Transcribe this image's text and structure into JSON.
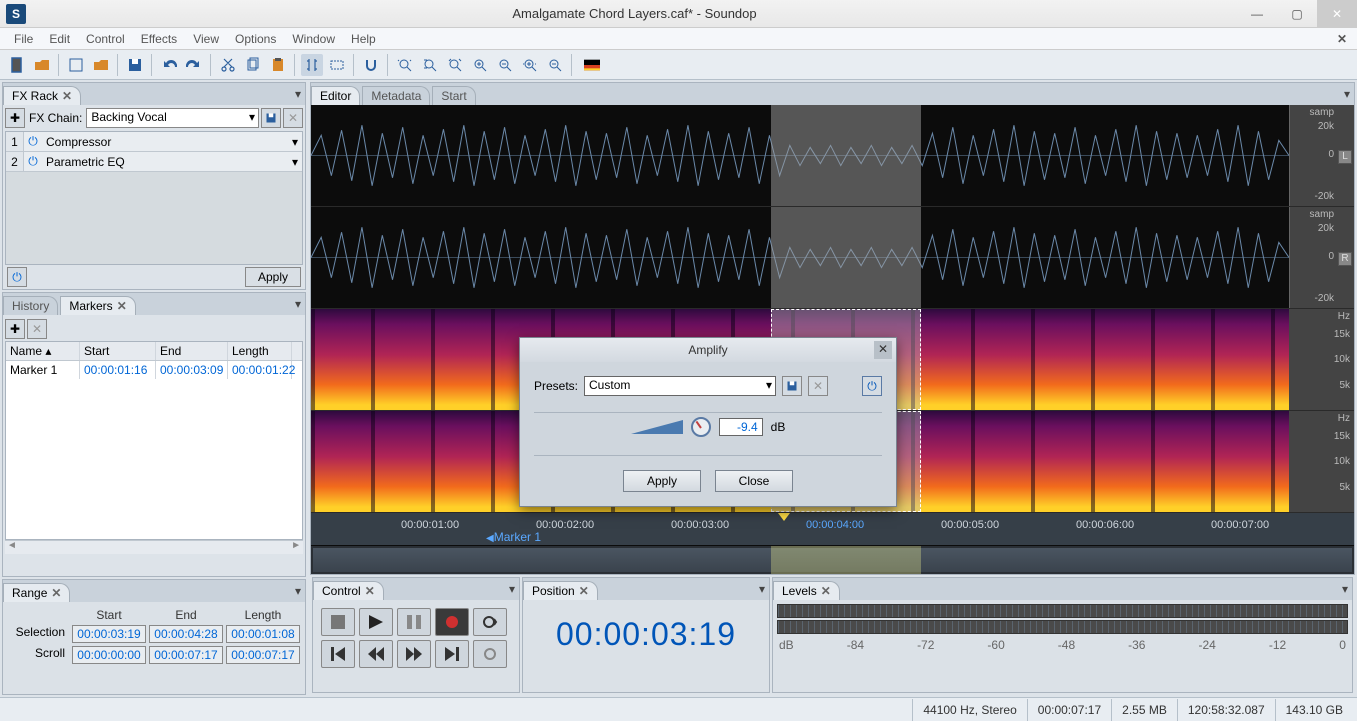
{
  "window": {
    "title": "Amalgamate Chord Layers.caf* - Soundop",
    "app_icon": "S"
  },
  "menu": {
    "items": [
      "File",
      "Edit",
      "Control",
      "Effects",
      "View",
      "Options",
      "Window",
      "Help"
    ]
  },
  "left": {
    "fxrack": {
      "tab": "FX Rack",
      "chain_label": "FX Chain:",
      "chain_value": "Backing Vocal",
      "effects": [
        {
          "idx": "1",
          "name": "Compressor"
        },
        {
          "idx": "2",
          "name": "Parametric EQ"
        }
      ],
      "apply": "Apply"
    },
    "markers": {
      "tabs": [
        "History",
        "Markers"
      ],
      "cols": {
        "name": "Name",
        "start": "Start",
        "end": "End",
        "length": "Length"
      },
      "rows": [
        {
          "name": "Marker 1",
          "start": "00:00:01:16",
          "end": "00:00:03:09",
          "length": "00:00:01:22"
        }
      ]
    }
  },
  "editor": {
    "tabs": [
      "Editor",
      "Metadata",
      "Start"
    ],
    "wave_ruler": {
      "unit": "samp",
      "up": "20k",
      "mid": "0",
      "down": "-20k",
      "chL": "L",
      "chR": "R"
    },
    "spec_ruler": {
      "unit": "Hz",
      "a": "15k",
      "b": "10k",
      "c": "5k"
    },
    "timeline": {
      "ticks": [
        "00:00:01:00",
        "00:00:02:00",
        "00:00:03:00",
        "00:00:04:00",
        "00:00:05:00",
        "00:00:06:00",
        "00:00:07:00"
      ],
      "marker": "Marker 1"
    }
  },
  "bottom": {
    "range": {
      "tab": "Range",
      "hdr": {
        "start": "Start",
        "end": "End",
        "length": "Length"
      },
      "rows": {
        "selection": {
          "label": "Selection",
          "start": "00:00:03:19",
          "end": "00:00:04:28",
          "length": "00:00:01:08"
        },
        "scroll": {
          "label": "Scroll",
          "start": "00:00:00:00",
          "end": "00:00:07:17",
          "length": "00:00:07:17"
        }
      }
    },
    "control": {
      "tab": "Control"
    },
    "position": {
      "tab": "Position",
      "value": "00:00:03:19"
    },
    "levels": {
      "tab": "Levels",
      "unit": "dB",
      "scale": [
        "-84",
        "-72",
        "-60",
        "-48",
        "-36",
        "-24",
        "-12",
        "0"
      ]
    }
  },
  "status": {
    "format": "44100 Hz, Stereo",
    "length": "00:00:07:17",
    "size": "2.55 MB",
    "uptime": "120:58:32.087",
    "disk": "143.10 GB"
  },
  "dialog": {
    "title": "Amplify",
    "presets_label": "Presets:",
    "presets_value": "Custom",
    "gain": "-9.4",
    "unit": "dB",
    "apply": "Apply",
    "close": "Close"
  }
}
